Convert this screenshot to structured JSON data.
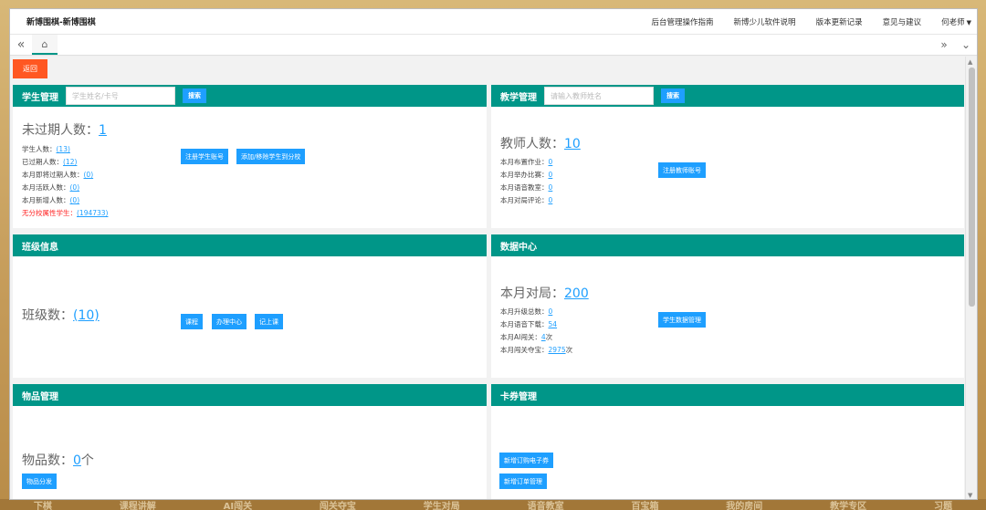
{
  "app": {
    "title": "新博围棋-新博围棋",
    "nav": [
      "后台管理操作指南",
      "新博少儿软件说明",
      "版本更新记录",
      "意见与建议"
    ],
    "user": "何老师"
  },
  "tabs": {
    "left": "«",
    "home": "⌂",
    "right1": "»",
    "right2": "⌄"
  },
  "back_label": "返回",
  "student": {
    "title": "学生管理",
    "placeholder": "学生姓名/卡号",
    "search": "搜索",
    "big_label": "未过期人数：",
    "big_value": "1",
    "stats": [
      {
        "label": "学生人数：",
        "value": "(13)"
      },
      {
        "label": "已过期人数：",
        "value": "(12)"
      },
      {
        "label": "本月即将过期人数：",
        "value": "(0)"
      },
      {
        "label": "本月活跃人数：",
        "value": "(0)"
      },
      {
        "label": "本月新增人数：",
        "value": "(0)"
      }
    ],
    "unassigned_label": "无分校属性学生：",
    "unassigned_value": "(194733)",
    "btn_register": "注册学生账号",
    "btn_add": "添加/移除学生到分校"
  },
  "teacher": {
    "title": "教学管理",
    "placeholder": "请输入教师姓名",
    "search": "搜索",
    "big_label": "教师人数：",
    "big_value": "10",
    "stats": [
      {
        "label": "本月布置作业：",
        "value": "0"
      },
      {
        "label": "本月举办比赛：",
        "value": "0"
      },
      {
        "label": "本月语音教室：",
        "value": "0"
      },
      {
        "label": "本月对局评论：",
        "value": "0"
      }
    ],
    "btn_register": "注册教师账号"
  },
  "class": {
    "title": "班级信息",
    "big_label": "班级数：",
    "big_value": "(10)",
    "btn_course": "课程",
    "btn_office": "办理中心",
    "btn_record": "记上课"
  },
  "data": {
    "title": "数据中心",
    "big_label": "本月对局：",
    "big_value": "200",
    "stats": [
      {
        "label": "本月升级总数：",
        "value": "0",
        "suffix": ""
      },
      {
        "label": "本月语音下载：",
        "value": "54",
        "suffix": ""
      },
      {
        "label": "本月AI闯关：",
        "value": "4",
        "suffix": "次"
      },
      {
        "label": "本月闯关夺宝：",
        "value": "2975",
        "suffix": "次"
      }
    ],
    "btn_manage": "学生数据管理"
  },
  "goods": {
    "title": "物品管理",
    "big_label": "物品数：",
    "big_value": "0",
    "big_unit": "个",
    "btn_dist": "物品分发"
  },
  "card": {
    "title": "卡券管理",
    "btn_ecard": "新增订购电子券",
    "btn_order": "新增订单管理"
  },
  "bottom": [
    "下棋",
    "课程讲解",
    "AI闯关",
    "闯关夺宝",
    "学生对局",
    "语音教室",
    "百宝箱",
    "我的房间",
    "教学专区",
    "习题"
  ]
}
